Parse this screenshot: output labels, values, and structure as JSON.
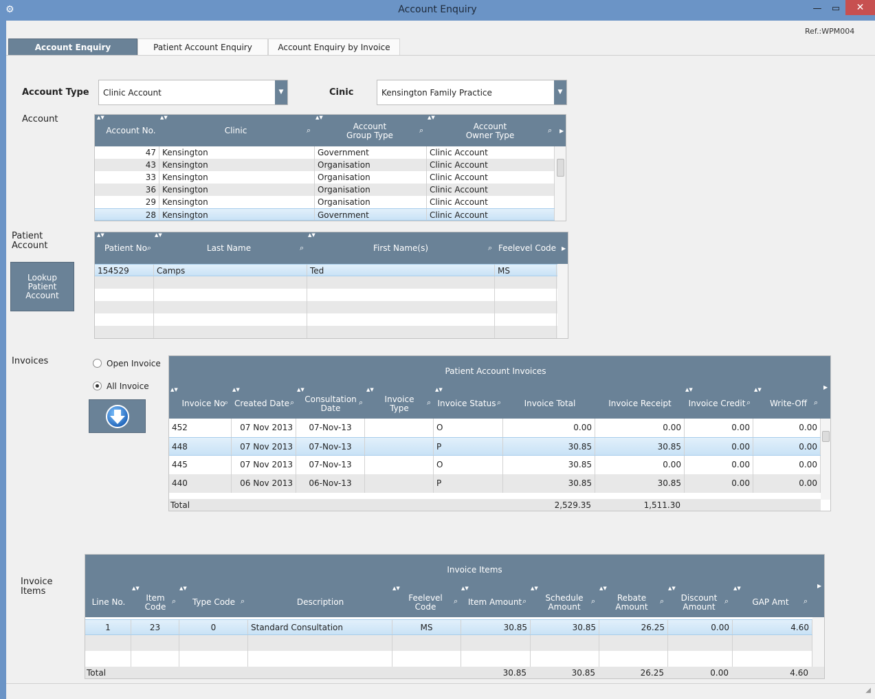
{
  "window": {
    "title": "Account Enquiry",
    "minimize": "—",
    "maximize": "▭",
    "close": "✕"
  },
  "ref": "Ref.:WPM004",
  "tabs": [
    {
      "label": "Account Enquiry",
      "active": true
    },
    {
      "label": "Patient Account Enquiry",
      "active": false
    },
    {
      "label": "Account Enquiry by Invoice",
      "active": false
    }
  ],
  "filters": {
    "account_type_label": "Account Type",
    "account_type_value": "Clinic Account",
    "clinic_label": "Cinic",
    "clinic_value": "Kensington Family Practice"
  },
  "account": {
    "label": "Account",
    "columns": [
      "Account No.",
      "Clinic",
      "Account\nGroup Type",
      "Account\nOwner Type"
    ],
    "rows": [
      [
        "47",
        "Kensington",
        "Government",
        "Clinic Account"
      ],
      [
        "43",
        "Kensington",
        "Organisation",
        "Clinic Account"
      ],
      [
        "33",
        "Kensington",
        "Organisation",
        "Clinic Account"
      ],
      [
        "36",
        "Kensington",
        "Organisation",
        "Clinic Account"
      ],
      [
        "29",
        "Kensington",
        "Organisation",
        "Clinic Account"
      ],
      [
        "28",
        "Kensington",
        "Government",
        "Clinic Account"
      ]
    ],
    "selected_row": 5
  },
  "patient": {
    "label_line1": "Patient",
    "label_line2": "Account",
    "lookup_button": "Lookup\nPatient\nAccount",
    "columns": [
      "Patient No",
      "Last Name",
      "First Name(s)",
      "Feelevel Code"
    ],
    "rows": [
      [
        "154529",
        "Camps",
        "Ted",
        "MS"
      ]
    ]
  },
  "invoices": {
    "label": "Invoices",
    "radio_open": "Open Invoice",
    "radio_all": "All Invoice",
    "selected_radio": "all",
    "grid_title": "Patient Account Invoices",
    "columns": [
      "Invoice No",
      "Created Date",
      "Consultation\nDate",
      "Invoice\nType",
      "Invoice Status",
      "Invoice Total",
      "Invoice Receipt",
      "Invoice Credit",
      "Write-Off"
    ],
    "rows": [
      [
        "452",
        "07 Nov 2013",
        "07-Nov-13",
        "",
        "O",
        "0.00",
        "0.00",
        "0.00",
        "0.00"
      ],
      [
        "448",
        "07 Nov 2013",
        "07-Nov-13",
        "",
        "P",
        "30.85",
        "30.85",
        "0.00",
        "0.00"
      ],
      [
        "445",
        "07 Nov 2013",
        "07-Nov-13",
        "",
        "O",
        "30.85",
        "0.00",
        "0.00",
        "0.00"
      ],
      [
        "440",
        "06 Nov 2013",
        "06-Nov-13",
        "",
        "P",
        "30.85",
        "30.85",
        "0.00",
        "0.00"
      ]
    ],
    "selected_row": 1,
    "total_label": "Total",
    "total_invoice": "2,529.35",
    "total_receipt": "1,511.30"
  },
  "items": {
    "label_line1": "Invoice",
    "label_line2": "Items",
    "grid_title": "Invoice Items",
    "columns": [
      "Line No.",
      "Item\nCode",
      "Type Code",
      "Description",
      "Feelevel\nCode",
      "Item Amount",
      "Schedule\nAmount",
      "Rebate\nAmount",
      "Discount\nAmount",
      "GAP Amt"
    ],
    "rows": [
      [
        "1",
        "23",
        "0",
        "Standard Consultation",
        "MS",
        "30.85",
        "30.85",
        "26.25",
        "0.00",
        "4.60"
      ]
    ],
    "total_label": "Total",
    "totals": [
      "30.85",
      "30.85",
      "26.25",
      "0.00",
      "4.60"
    ]
  },
  "colors": {
    "header_bg": "#6a8297",
    "selected_row": "#c9e2f6",
    "titlebar": "#6b94c6",
    "close_button": "#c75050"
  }
}
